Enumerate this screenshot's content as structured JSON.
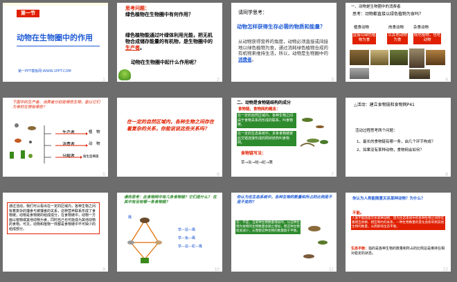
{
  "colors": {
    "red": "#e02000",
    "blue": "#1f5bd6",
    "green": "#0a7a2a",
    "orange": "#e26b00",
    "purple": "#7030a0",
    "yellow_bg": "#fffbe6"
  },
  "slides": [
    {
      "num": "1",
      "tag": "第一节",
      "title": "动物在生物圈中的作用",
      "footer": "第一PPT模板网-WWW.1PPT.COM"
    },
    {
      "num": "2",
      "q_label": "思考问题：",
      "q_text": "绿色植物在生物圈中有何作用？",
      "body1": "绿色植物能通过叶绿体利用光能，把无机物合成储存能量的有机物，是生物圈中的",
      "body1_hl": "生产者",
      "body1_end": "。",
      "body2": "动物在生物圈中起什么作用呢？"
    },
    {
      "num": "3",
      "intro": "请同学思考：",
      "question": "动物怎样获得生存必需的物质和能量？",
      "body": "从动物获得营养的角度，动物必须直接或间接地以绿色植物为食，通过消耗绿色植物合成的有机物来维持生活，所以，动物是生物圈中的",
      "body_hl": "消费者",
      "body_end": "。"
    },
    {
      "num": "4",
      "head": "一、动物是生物圈中的消费者",
      "think": "思考：动物都直接以绿色植物为食吗？",
      "labels": [
        "植食动物",
        "肉食动物",
        "杂食动物"
      ],
      "boxes": [
        "直接以绿色植物为食",
        "以其他动物为食",
        "既吃植物，也吃动物"
      ]
    },
    {
      "num": "5",
      "q": "下图中的生产者、消费者分别是哪些生物，能以它们为食的生物有哪些？",
      "roles": [
        "生产者",
        "消费者",
        "分解者"
      ],
      "roles_r": [
        "植　物",
        "动　物",
        "腐生型细菌"
      ]
    },
    {
      "num": "6",
      "text": "在一定的自然区域内，各种生物之间存在着复杂的关系，你能说说这些关系吗？"
    },
    {
      "num": "7",
      "head": "二、动物是食物链结构的成分",
      "sub": "食物链、食物网的概念：",
      "def1": "在一定的自然区域内，各种生物之间由于食物关系而形成的联系，叫食物链。",
      "def2": "在一定的生态系统中，多条食物链彼此交错连接形成的网状结构叫食物网。",
      "formula": "食物链写法：",
      "chain": "草→虫→蛙→蛇→鹰"
    },
    {
      "num": "8",
      "head": "△活动：建立食物链和食物网P41",
      "intro": "活动过程思考两个问题：",
      "q1": "1、最长的食物链有哪一条，由几个环节构成？",
      "q2": "2、如果没有某种动物，食物网会如何？"
    },
    {
      "num": "9",
      "text": "通过活动，我们可以看出在一定的区域内，各种生物之间有着复杂的捕食与被捕食的关系，这种营养联系形成了食物链；动物是食物链的组成成分，在食物链中，动物一方面以植物或其他动物为食，同时自己也可能成为其他动物的食物。可见，动物和植物一样都是食物链中不可缺少的组成部分。"
    },
    {
      "num": "10",
      "q": "请你思考：此食物网中有几条食物链？它们是什么？ 在其中有没有哪一条食物链？",
      "chain1": "草—鼠—鹰",
      "chain2": "草—兔—鹰",
      "chain3": "草—鼠—蛇—鹰",
      "center": "鹰"
    },
    {
      "num": "11",
      "q": "你认为在生态系统中，各种生物的数量和所占的比例是不是不变的？",
      "ans": "答：不是，当某种生物数量增加时，以这种生物为食物的生物数量会随之增加，而这种生物就会减少，从而使这种生物的数量趋于平衡。"
    },
    {
      "num": "12",
      "q": "你认为人类能随意灭杀某种动物？为什么？",
      "ans_label": "不能。",
      "ans": "人类不能随意灭杀某种动物，因为生态系统中的各种生物之间存在着相互依赖、相互制约的关系，一种生物数量的变化会影响到其他生物的数量，从而影响生态平衡。",
      "term": "生态平衡：",
      "term_def": "指的是各种生物的数量和所占的比例总是维持在相对稳定的状态。"
    }
  ]
}
